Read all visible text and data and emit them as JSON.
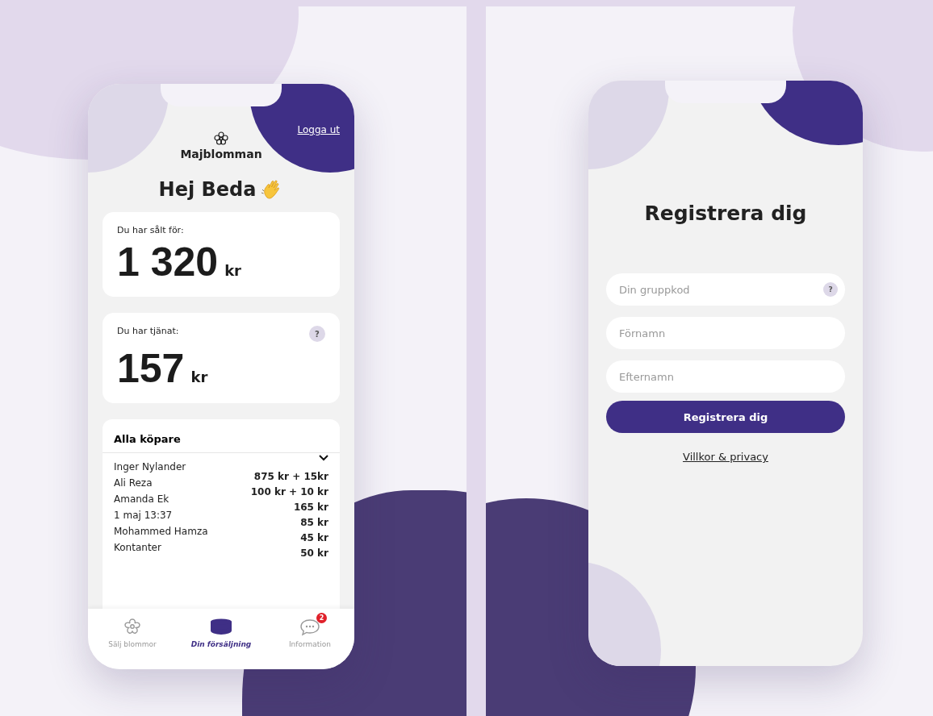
{
  "sales_screen": {
    "logout_link": "Logga ut",
    "logo_text": "Majblomman",
    "greeting": "Hej Beda",
    "sold_card": {
      "label": "Du har sålt för:",
      "amount": "1 320",
      "unit": "kr"
    },
    "earned_card": {
      "label": "Du har tjänat:",
      "amount": "157",
      "unit": "kr",
      "help": "?"
    },
    "buyers": {
      "title": "Alla köpare",
      "names": [
        "Inger Nylander",
        "Ali Reza",
        "Amanda Ek",
        "1 maj 13:37",
        "Mohammed Hamza",
        "Kontanter"
      ],
      "amounts": [
        "875 kr + 15kr",
        "100 kr + 10 kr",
        "165 kr",
        "85 kr",
        "45 kr",
        "50 kr"
      ]
    },
    "tabs": [
      {
        "label": "Sälj blommor",
        "kind": "flower",
        "selected": false
      },
      {
        "label": "Din försäljning",
        "kind": "coins",
        "selected": true
      },
      {
        "label": "Information",
        "kind": "chat",
        "selected": false,
        "badge": "2"
      }
    ]
  },
  "register_screen": {
    "title": "Registrera dig",
    "fields": [
      {
        "placeholder": "Din gruppkod",
        "help": "?"
      },
      {
        "placeholder": "Förnamn"
      },
      {
        "placeholder": "Efternamn"
      }
    ],
    "button": "Registrera dig",
    "terms_link": "Villkor & privacy"
  }
}
